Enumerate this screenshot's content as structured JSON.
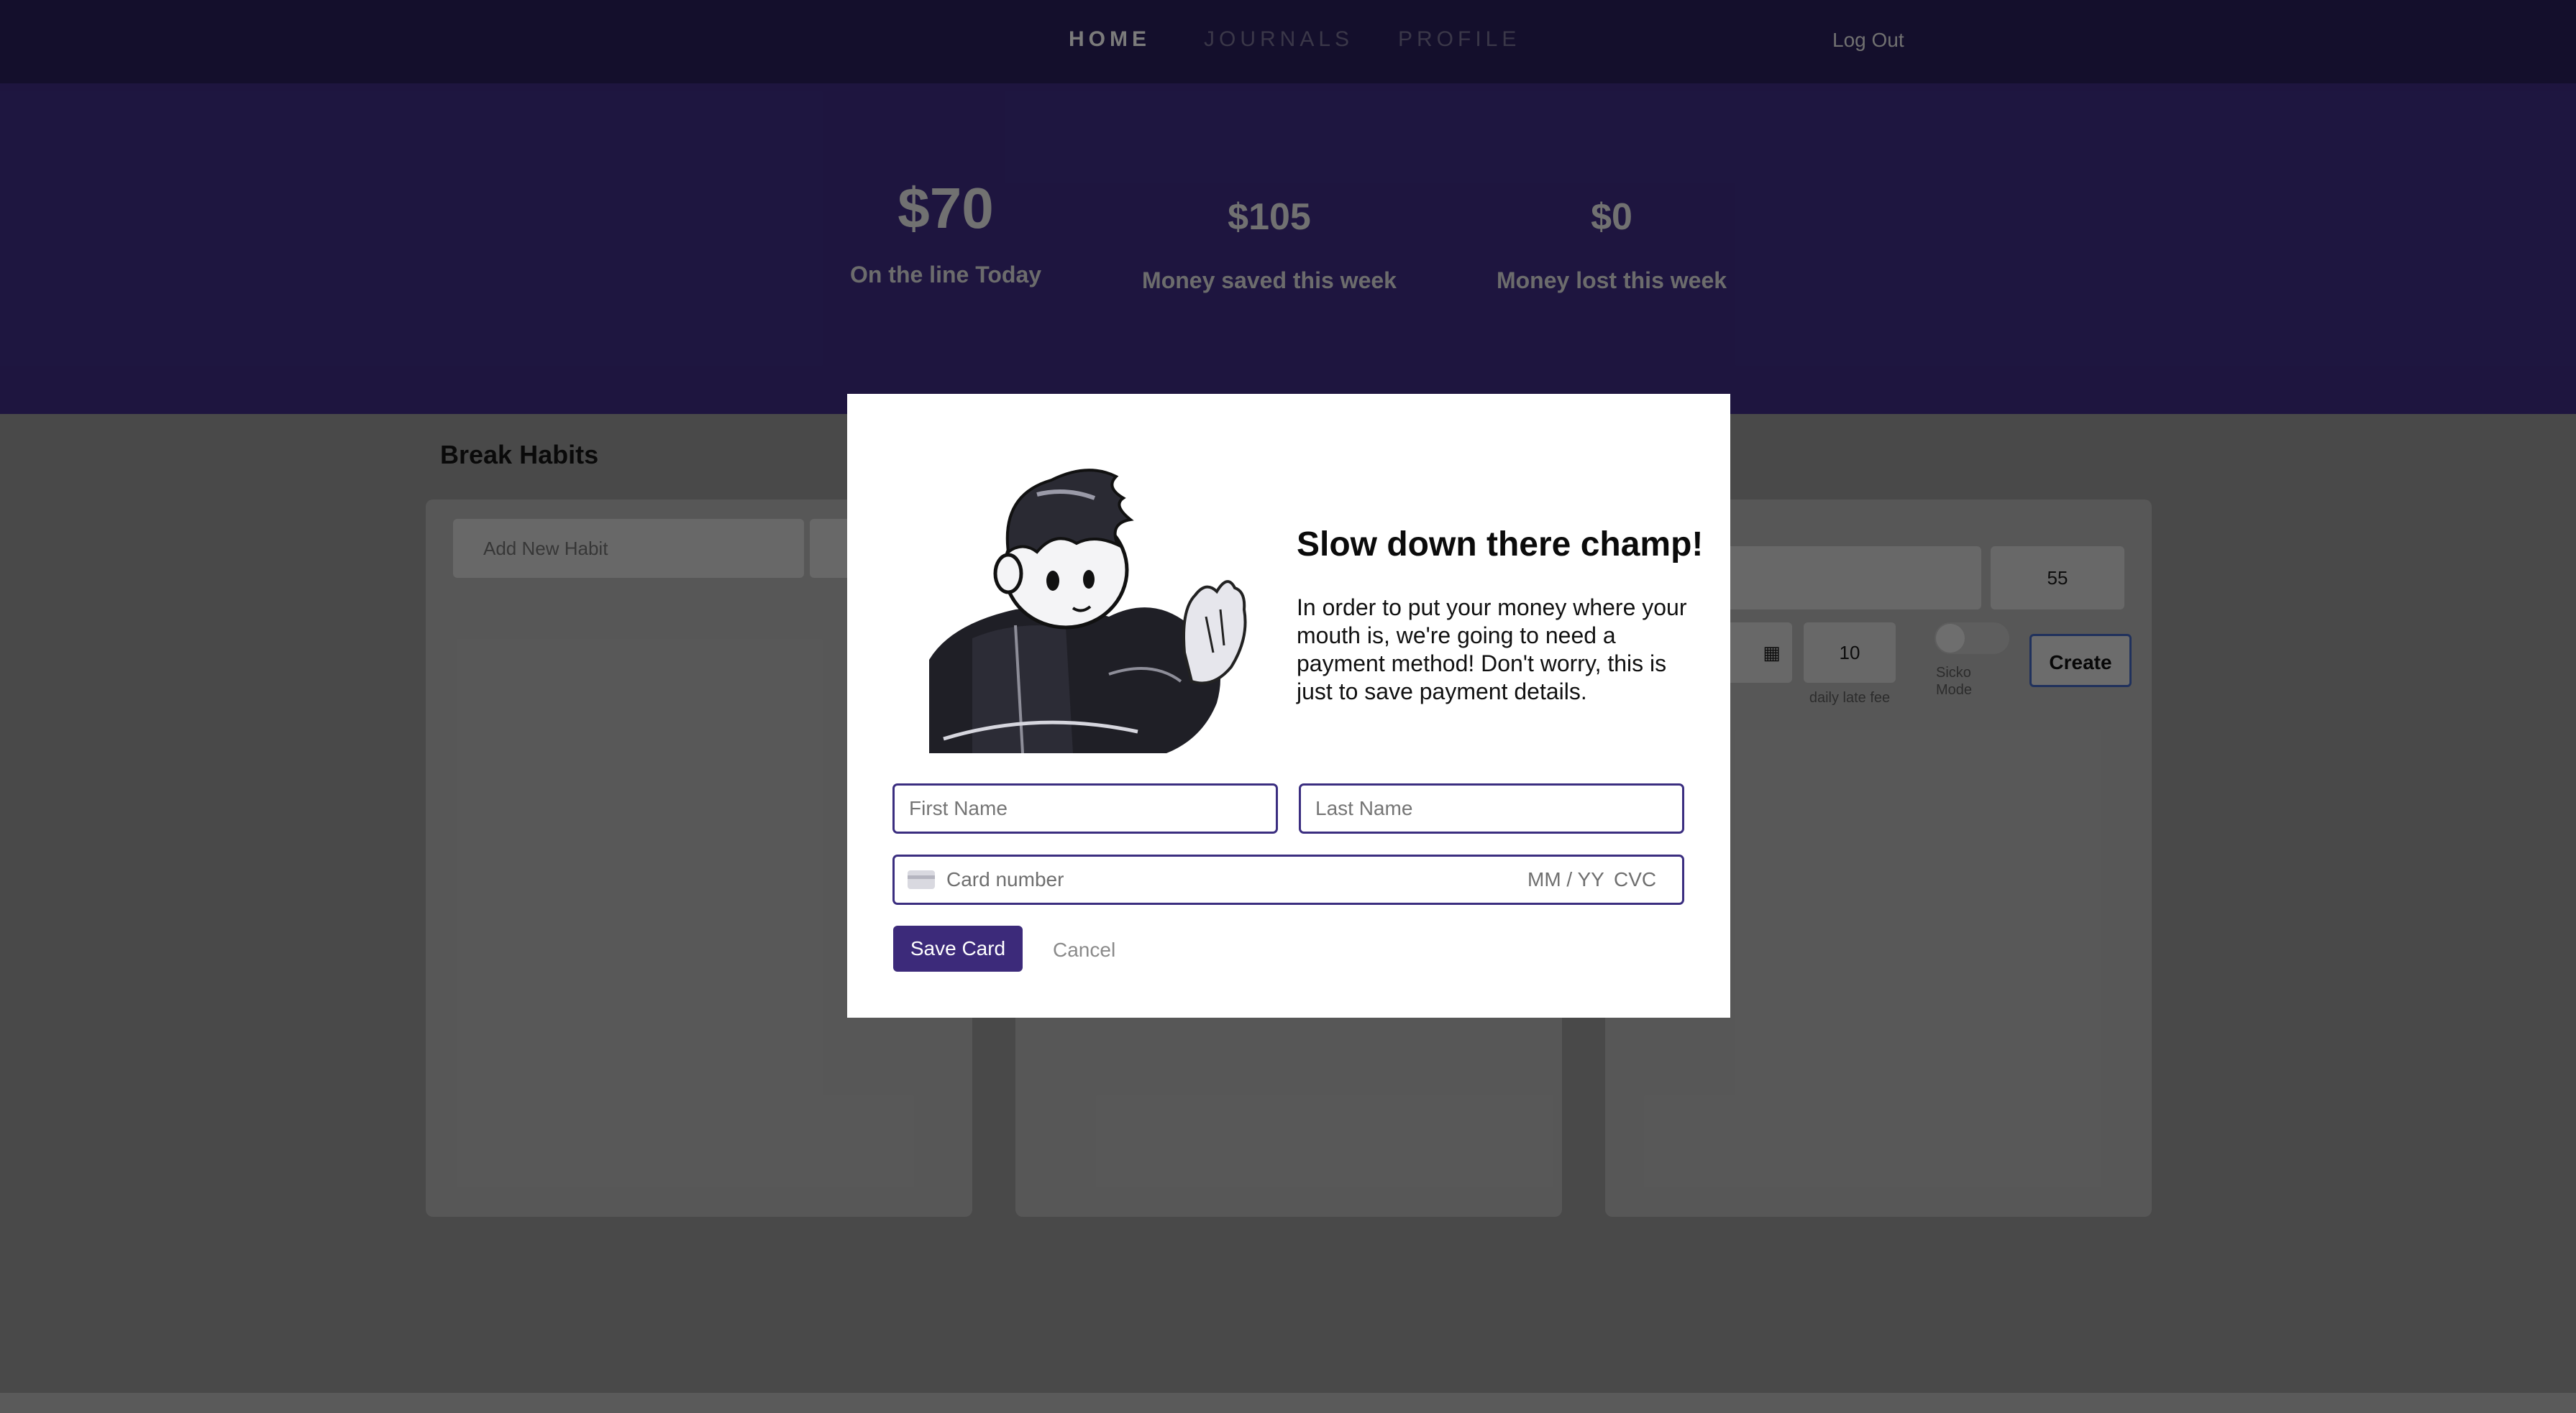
{
  "nav": {
    "home": "HOME",
    "journals": "JOURNALS",
    "profile": "PROFILE",
    "logout": "Log Out"
  },
  "stats": [
    {
      "value": "$70",
      "label": "On the line Today"
    },
    {
      "value": "$105",
      "label": "Money saved this week"
    },
    {
      "value": "$0",
      "label": "Money lost this week"
    }
  ],
  "main": {
    "title": "Break Habits",
    "add_habit_placeholder": "Add New Habit",
    "amount_value": "55",
    "late_fee_value": "10",
    "late_fee_label": "daily late fee",
    "toggle_label": "Sicko Mode",
    "create_label": "Create"
  },
  "modal": {
    "title": "Slow down there champ!",
    "body": "In order to put your money where your mouth is, we're going to need a payment method! Don't worry, this is just to save payment details.",
    "first_name_placeholder": "First Name",
    "last_name_placeholder": "Last Name",
    "card_placeholder": "Card number",
    "expiry_placeholder": "MM / YY",
    "cvc_placeholder": "CVC",
    "save_label": "Save Card",
    "cancel_label": "Cancel"
  },
  "colors": {
    "brand": "#3c2a7a",
    "nav": "#281d55",
    "hero": "#3a2a7a"
  },
  "icons": [
    "card-icon",
    "calendar-icon",
    "toggle-switch",
    "mascot-illustration"
  ]
}
